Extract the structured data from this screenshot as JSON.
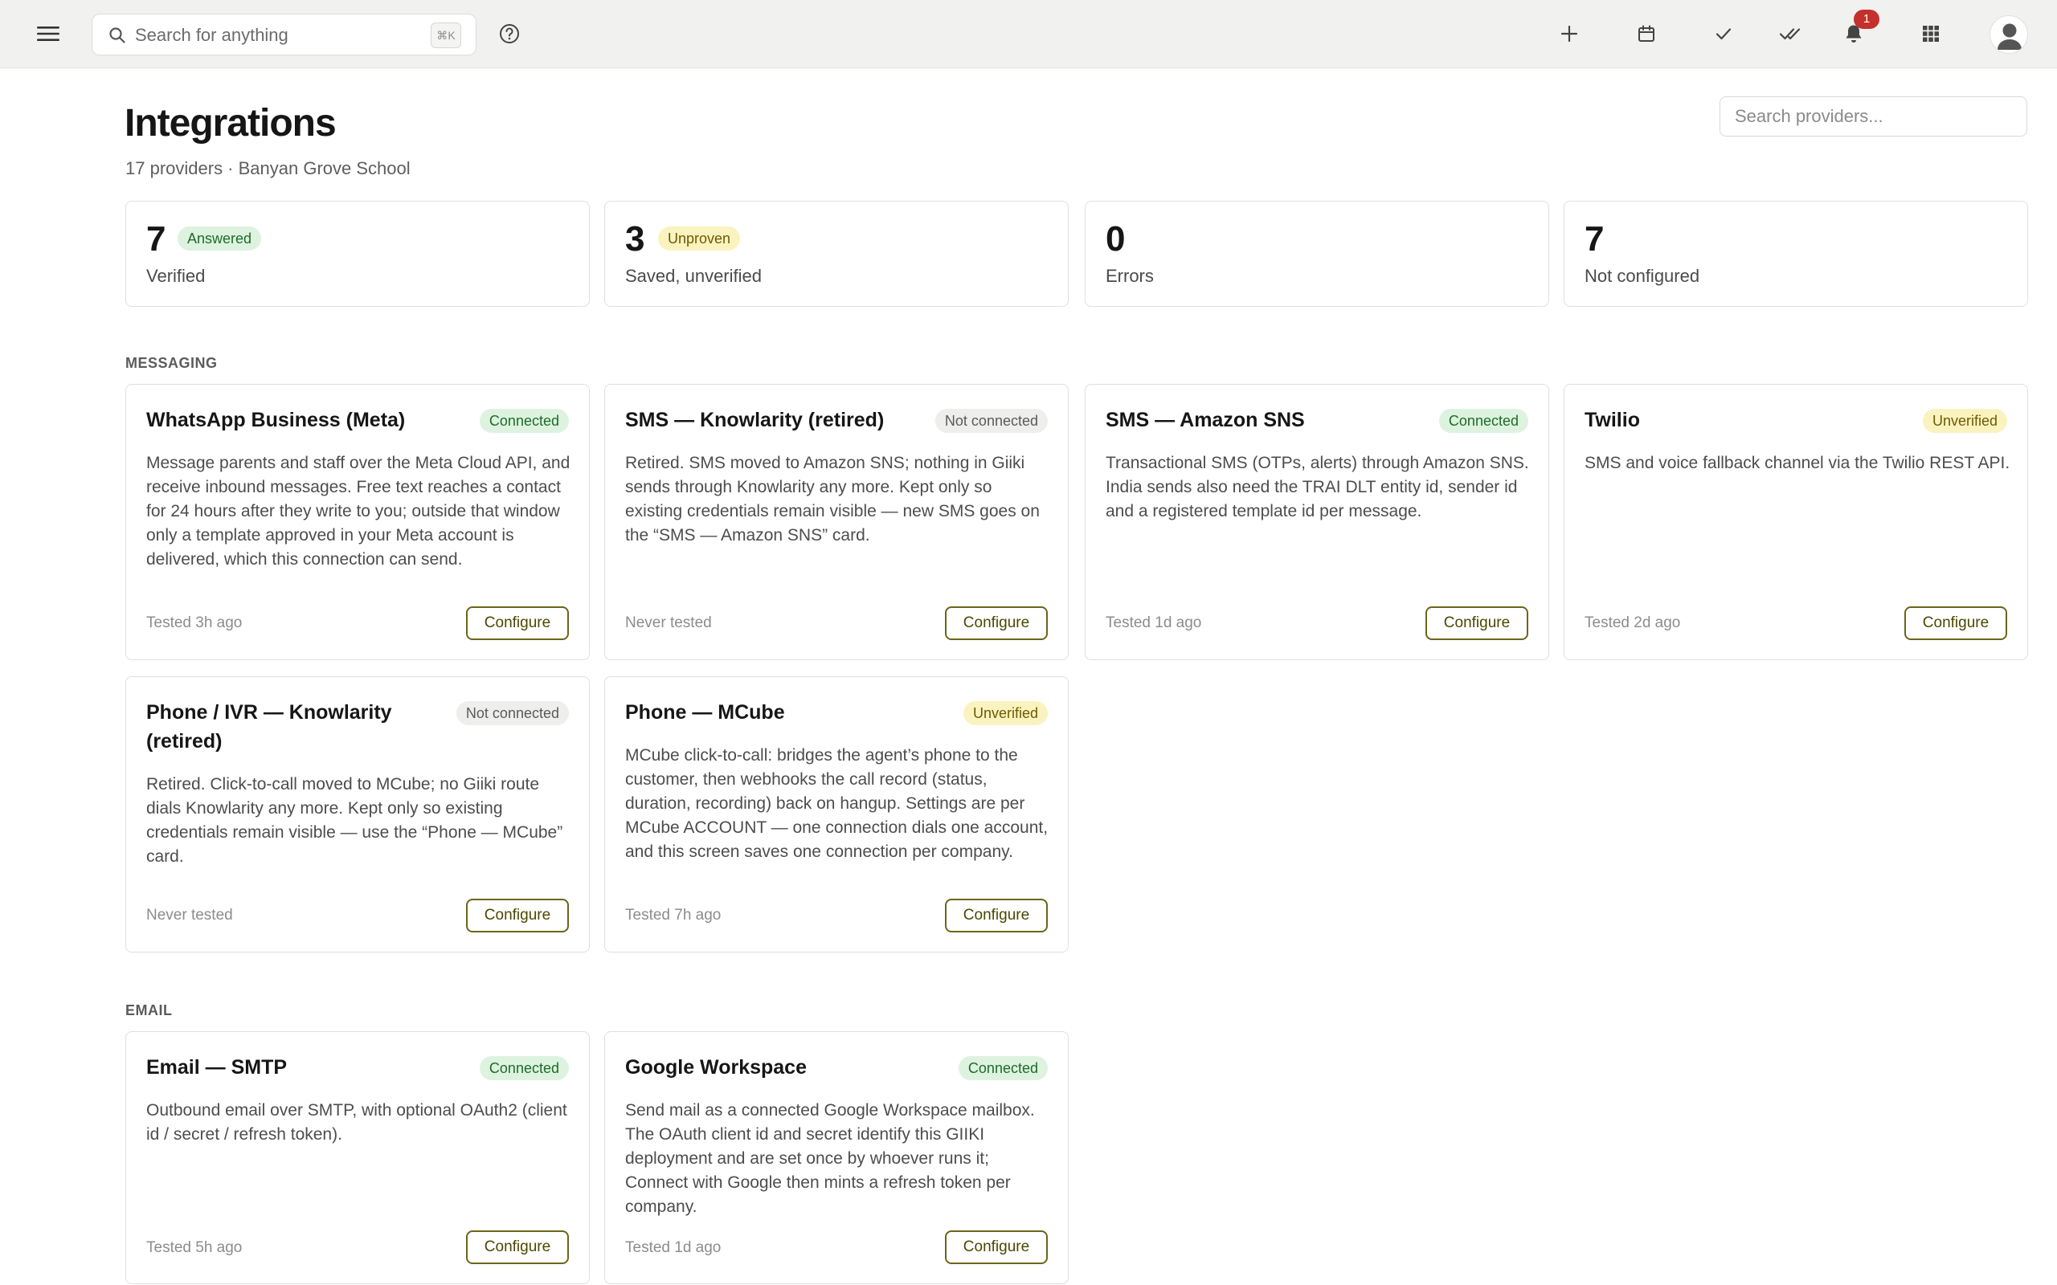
{
  "topbar": {
    "search_placeholder": "Search for anything",
    "search_shortcut": "⌘K",
    "notification_count": "1"
  },
  "header": {
    "title": "Integrations",
    "subtitle": "17 providers · Banyan Grove School",
    "provider_search_placeholder": "Search providers..."
  },
  "stats": [
    {
      "value": "7",
      "pill": "Answered",
      "label": "Verified"
    },
    {
      "value": "3",
      "pill": "Unproven",
      "label": "Saved, unverified"
    },
    {
      "value": "0",
      "pill": "",
      "label": "Errors"
    },
    {
      "value": "7",
      "pill": "",
      "label": "Not configured"
    }
  ],
  "sections": {
    "messaging": "MESSAGING",
    "email": "EMAIL"
  },
  "providers": [
    {
      "title": "WhatsApp Business (Meta)",
      "status": "Connected",
      "description": "Message parents and staff over the Meta Cloud API, and receive inbound messages. Free text reaches a contact for 24 hours after they write to you; outside that window only a template approved in your Meta account is delivered, which this connection can send.",
      "tested": "Tested 3h ago",
      "button": "Configure"
    },
    {
      "title": "SMS — Knowlarity (retired)",
      "status": "Not connected",
      "description": "Retired. SMS moved to Amazon SNS; nothing in Giiki sends through Knowlarity any more. Kept only so existing credentials remain visible — new SMS goes on the “SMS — Amazon SNS” card.",
      "tested": "Never tested",
      "button": "Configure"
    },
    {
      "title": "SMS — Amazon SNS",
      "status": "Connected",
      "description": "Transactional SMS (OTPs, alerts) through Amazon SNS. India sends also need the TRAI DLT entity id, sender id and a registered template id per message.",
      "tested": "Tested 1d ago",
      "button": "Configure"
    },
    {
      "title": "Twilio",
      "status": "Unverified",
      "description": "SMS and voice fallback channel via the Twilio REST API.",
      "tested": "Tested 2d ago",
      "button": "Configure"
    },
    {
      "title": "Phone / IVR — Knowlarity (retired)",
      "status": "Not connected",
      "description": "Retired. Click-to-call moved to MCube; no Giiki route dials Knowlarity any more. Kept only so existing credentials remain visible — use the “Phone — MCube” card.",
      "tested": "Never tested",
      "button": "Configure"
    },
    {
      "title": "Phone — MCube",
      "status": "Unverified",
      "description": "MCube click-to-call: bridges the agent’s phone to the customer, then webhooks the call record (status, duration, recording) back on hangup. Settings are per MCube ACCOUNT — one connection dials one account, and this screen saves one connection per company.",
      "tested": "Tested 7h ago",
      "button": "Configure"
    },
    {
      "title": "Email — SMTP",
      "status": "Connected",
      "description": "Outbound email over SMTP, with optional OAuth2 (client id / secret / refresh token).",
      "tested": "Tested 5h ago",
      "button": "Configure"
    },
    {
      "title": "Google Workspace",
      "status": "Connected",
      "description": "Send mail as a connected Google Workspace mailbox. The OAuth client id and secret identify this GIIKI deployment and are set once by whoever runs it; Connect with Google then mints a refresh token per company.",
      "tested": "Tested 1d ago",
      "button": "Configure"
    }
  ],
  "colors": {
    "connected_bg": "#ddf3df",
    "unverified_bg": "#fbf3bf",
    "not_connected_bg": "#eeeeec",
    "configure_border": "#6b6519",
    "notification_badge": "#c4302b"
  }
}
